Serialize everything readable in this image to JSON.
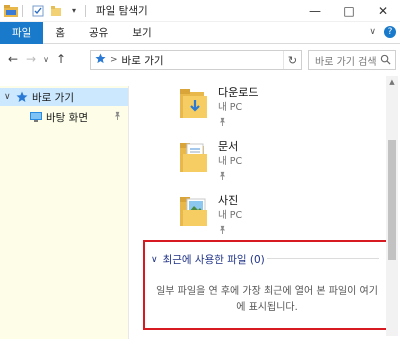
{
  "window": {
    "title": "파일 탐색기",
    "minimize": "—",
    "maximize": "□",
    "close": "✕"
  },
  "ribbon": {
    "tabs": [
      {
        "label": "파일"
      },
      {
        "label": "홈"
      },
      {
        "label": "공유"
      },
      {
        "label": "보기"
      }
    ],
    "expand": "∨",
    "help": "?"
  },
  "address": {
    "back": "←",
    "forward": "→",
    "recent": "∨",
    "up": "↑",
    "chevron": ">",
    "path": "바로 가기",
    "refresh": "↻"
  },
  "search": {
    "placeholder": "바로 가기 검색"
  },
  "sidebar": {
    "items": [
      {
        "label": "바로 가기",
        "chevron": "∨"
      },
      {
        "label": "바탕 화면"
      }
    ]
  },
  "folders": [
    {
      "name": "다운로드",
      "location": "내 PC"
    },
    {
      "name": "문서",
      "location": "내 PC"
    },
    {
      "name": "사진",
      "location": "내 PC"
    }
  ],
  "recent": {
    "chevron": "∨",
    "title": "최근에 사용한 파일 (0)",
    "message": "일부 파일을 연 후에 가장 최근에 열어 본 파일이 여기에 표시됩니다."
  },
  "colors": {
    "accent": "#1979ca",
    "selection": "#cce8ff",
    "highlight_border": "#d71921",
    "section_title": "#1e3287",
    "left_pane_bg": "#fdfde8"
  }
}
